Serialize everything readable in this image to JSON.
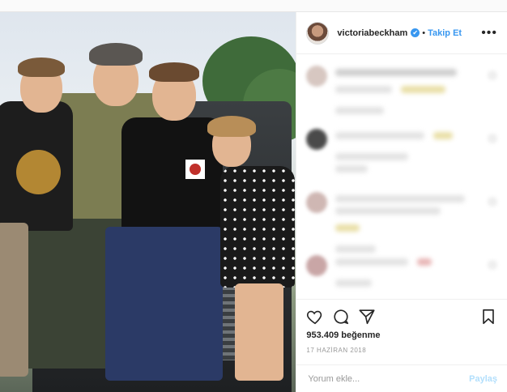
{
  "header": {
    "username": "victoriabeckham",
    "verified_glyph": "✔",
    "separator": "•",
    "follow_label": "Takip Et",
    "more_glyph": "•••"
  },
  "photo": {
    "content": "Family photo of a man in a flat cap with three boys and a girl sitting on the hood of a dark Land Rover"
  },
  "comments": {
    "note_hidden": "blurred comments"
  },
  "actions": {
    "icons": [
      "heart-icon",
      "comment-icon",
      "share-icon",
      "bookmark-icon"
    ],
    "likes": "953.409 beğenme",
    "date": "17 HAZİRAN 2018"
  },
  "add_comment": {
    "placeholder": "Yorum ekle...",
    "post_label": "Paylaş"
  },
  "colors": {
    "accent": "#3897f0",
    "post_disabled": "#b2dffc"
  }
}
